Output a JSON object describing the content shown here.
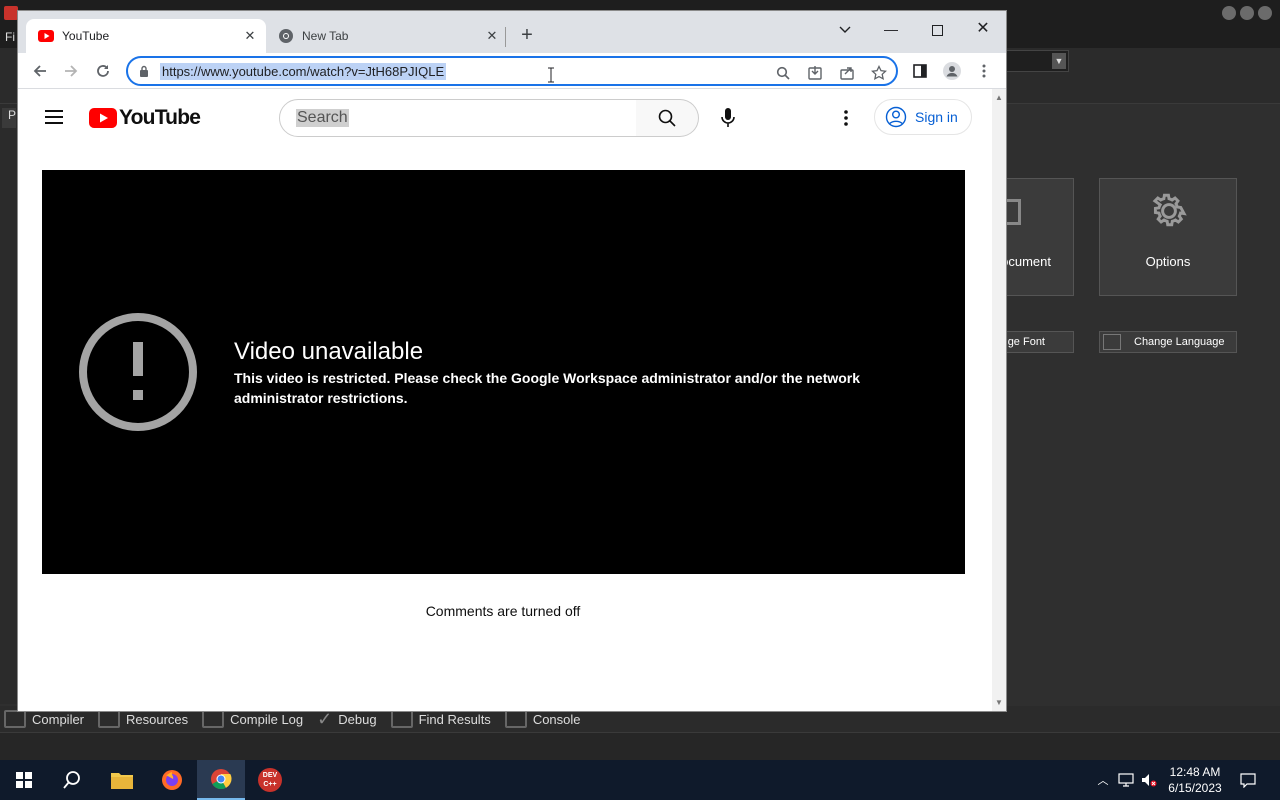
{
  "background_app": {
    "menu_label": "Fi",
    "left_tab_label": "P",
    "tiles": [
      {
        "label": "ocument"
      },
      {
        "label": "Options"
      }
    ],
    "small_buttons": [
      {
        "label": "ge Font"
      },
      {
        "label": "Change Language"
      }
    ],
    "bottom_tabs": [
      {
        "label": "Compiler"
      },
      {
        "label": "Resources"
      },
      {
        "label": "Compile Log"
      },
      {
        "label": "Debug"
      },
      {
        "label": "Find Results"
      },
      {
        "label": "Console"
      }
    ]
  },
  "browser": {
    "tabs": [
      {
        "label": "YouTube",
        "active": true,
        "icon": "youtube-icon"
      },
      {
        "label": "New Tab",
        "active": false,
        "icon": "chrome-icon"
      }
    ],
    "url": "https://www.youtube.com/watch?v=JtH68PJIQLE",
    "accent": "#1a73e8"
  },
  "youtube": {
    "logo_text": "YouTube",
    "search_placeholder": "Search",
    "signin_label": "Sign in",
    "error_title": "Video unavailable",
    "error_message": "This video is restricted. Please check the Google Workspace administrator and/or the network administrator restrictions.",
    "comments_status": "Comments are turned off",
    "brand_color": "#ff0000"
  },
  "taskbar": {
    "apps": [
      "windows-start-icon",
      "search-icon",
      "file-explorer-icon",
      "firefox-icon",
      "chrome-icon",
      "devcpp-icon"
    ],
    "dev_label": "DEV C++",
    "time": "12:48 AM",
    "date": "6/15/2023"
  }
}
